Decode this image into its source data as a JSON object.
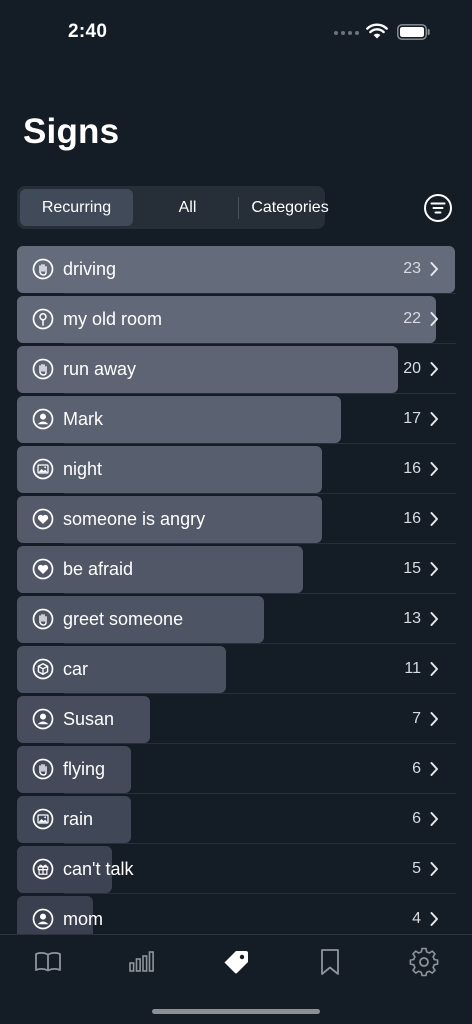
{
  "status": {
    "time": "2:40",
    "icons": [
      "signal-dots-icon",
      "wifi-icon",
      "battery-icon"
    ]
  },
  "page": {
    "title": "Signs"
  },
  "segments": [
    {
      "label": "Recurring",
      "active": true
    },
    {
      "label": "All",
      "active": false
    },
    {
      "label": "Categories",
      "active": false
    }
  ],
  "filter": {
    "icon": "filter-icon"
  },
  "max_count": 23,
  "signs": [
    {
      "label": "driving",
      "count": "23",
      "icon": "hand-icon",
      "fill": 1.0
    },
    {
      "label": "my old room",
      "count": "22",
      "icon": "place-pin-icon",
      "fill": 0.957
    },
    {
      "label": "run away",
      "count": "20",
      "icon": "hand-icon",
      "fill": 0.87
    },
    {
      "label": "Mark",
      "count": "17",
      "icon": "person-icon",
      "fill": 0.739
    },
    {
      "label": "night",
      "count": "16",
      "icon": "image-icon",
      "fill": 0.696
    },
    {
      "label": "someone is angry",
      "count": "16",
      "icon": "heart-icon",
      "fill": 0.696
    },
    {
      "label": "be afraid",
      "count": "15",
      "icon": "heart-icon",
      "fill": 0.652
    },
    {
      "label": "greet someone",
      "count": "13",
      "icon": "hand-icon",
      "fill": 0.565
    },
    {
      "label": "car",
      "count": "11",
      "icon": "cube-icon",
      "fill": 0.478
    },
    {
      "label": "Susan",
      "count": "7",
      "icon": "person-icon",
      "fill": 0.304
    },
    {
      "label": "flying",
      "count": "6",
      "icon": "hand-icon",
      "fill": 0.261
    },
    {
      "label": "rain",
      "count": "6",
      "icon": "image-icon",
      "fill": 0.261
    },
    {
      "label": "can't talk",
      "count": "5",
      "icon": "gift-icon",
      "fill": 0.217
    },
    {
      "label": "mom",
      "count": "4",
      "icon": "person-icon",
      "fill": 0.174
    }
  ],
  "tabs": [
    {
      "name": "journal",
      "icon": "book-icon",
      "active": false
    },
    {
      "name": "stats",
      "icon": "bar-chart-icon",
      "active": false
    },
    {
      "name": "signs",
      "icon": "tag-icon",
      "active": true
    },
    {
      "name": "bookmarks",
      "icon": "bookmark-icon",
      "active": false
    },
    {
      "name": "settings",
      "icon": "gear-icon",
      "active": false
    }
  ],
  "colors": {
    "background": "#141d25",
    "bar_top": "#646b7b",
    "bar_bottom": "#3a4050",
    "inactive_icon": "#8e949b",
    "active_icon": "#ffffff"
  }
}
